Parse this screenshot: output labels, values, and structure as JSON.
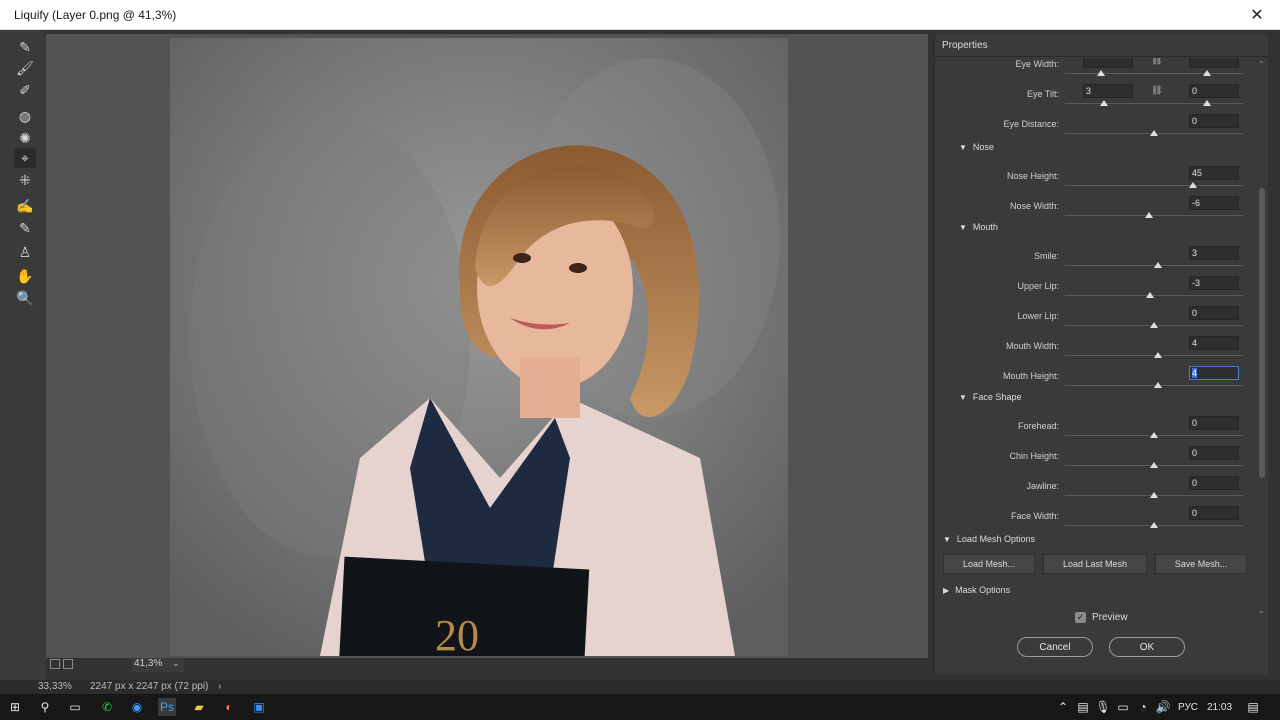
{
  "window": {
    "title": "Liquify (Layer 0.png @ 41,3%)",
    "close_glyph": "✕"
  },
  "tools": [
    {
      "icon": "forward-warp-icon",
      "glyph": "✎"
    },
    {
      "icon": "reconstruct-brush-icon",
      "glyph": "🖌"
    },
    {
      "icon": "smooth-brush-icon",
      "glyph": "✐"
    },
    {
      "icon": "twirl-icon",
      "glyph": "◍"
    },
    {
      "icon": "pucker-icon",
      "glyph": "✺"
    },
    {
      "icon": "face-tool-icon",
      "glyph": "⌖"
    },
    {
      "icon": "bloat-icon",
      "glyph": "⁜"
    },
    {
      "icon": "freeze-mask-icon",
      "glyph": "✍"
    },
    {
      "icon": "thaw-mask-icon",
      "glyph": "✎"
    },
    {
      "icon": "face-person-icon",
      "glyph": "♙"
    },
    {
      "icon": "hand-icon",
      "glyph": "✋"
    },
    {
      "icon": "zoom-icon",
      "glyph": "🔍"
    }
  ],
  "zoom": {
    "value": "41,3%",
    "caret": "⌄"
  },
  "panel": {
    "title": "Properties",
    "rows": [
      {
        "label": "Eye Width:",
        "left": "",
        "right": "",
        "linked": true,
        "thumb_left": 0.2,
        "thumb_right": 0.8
      },
      {
        "label": "Eye Tilt:",
        "left": "3",
        "right": "0",
        "linked": true,
        "thumb_left": 0.22,
        "thumb_right": 0.8
      },
      {
        "label": "Eye Distance:",
        "value": "0",
        "thumb": 0.5
      }
    ],
    "sections": [
      {
        "name": "Nose",
        "rows": [
          {
            "label": "Nose Height:",
            "value": "45",
            "thumb": 0.72
          },
          {
            "label": "Nose Width:",
            "value": "-6",
            "thumb": 0.47
          }
        ]
      },
      {
        "name": "Mouth",
        "rows": [
          {
            "label": "Smile:",
            "value": "3",
            "thumb": 0.52
          },
          {
            "label": "Upper Lip:",
            "value": "-3",
            "thumb": 0.48
          },
          {
            "label": "Lower Lip:",
            "value": "0",
            "thumb": 0.5
          },
          {
            "label": "Mouth Width:",
            "value": "4",
            "thumb": 0.52
          },
          {
            "label": "Mouth Height:",
            "value": "4",
            "thumb": 0.52,
            "selected": true
          }
        ]
      },
      {
        "name": "Face Shape",
        "rows": [
          {
            "label": "Forehead:",
            "value": "0",
            "thumb": 0.5
          },
          {
            "label": "Chin Height:",
            "value": "0",
            "thumb": 0.5
          },
          {
            "label": "Jawline:",
            "value": "0",
            "thumb": 0.5
          },
          {
            "label": "Face Width:",
            "value": "0",
            "thumb": 0.5
          }
        ]
      }
    ],
    "load_mesh": {
      "title": "Load Mesh Options",
      "buttons": [
        "Load Mesh...",
        "Load Last Mesh",
        "Save Mesh..."
      ]
    },
    "mask_options": "Mask Options",
    "preview": {
      "label": "Preview",
      "checked": true
    },
    "cancel": "Cancel",
    "ok": "OK"
  },
  "status": {
    "zoom": "33,33%",
    "doc": "2247 px x 2247 px (72 ppi)",
    "arrow": "›"
  },
  "taskbar": {
    "language": "РУС",
    "time": "21:03"
  }
}
